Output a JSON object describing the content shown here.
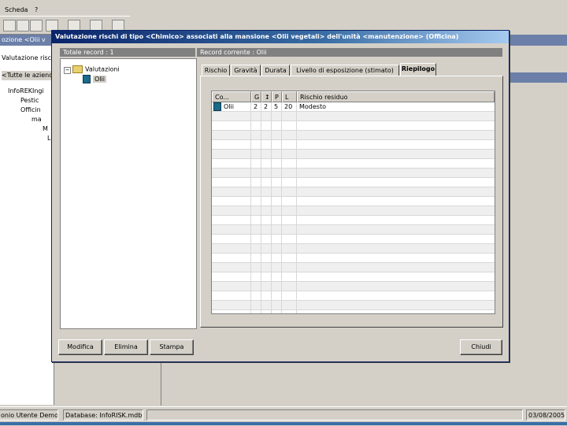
{
  "app": {
    "menu": [
      "Scheda",
      "?"
    ],
    "left_title": "ozione <Olii v",
    "left_items": [
      "Valutazione risch",
      "<Tutte le aziende",
      "InfoREKIngi",
      "Pestic",
      "Officin",
      "ma",
      "M",
      "L"
    ],
    "status": {
      "user": "onio  Utente Demo",
      "database": "Database: InfoRISK.mdb",
      "date": "03/08/2005"
    }
  },
  "dialog": {
    "title": "Valutazione rischi di tipo <Chimico> associati alla mansione <Olii vegetali> dell'unità <manutenzione> (Officina)",
    "left_header": "Totale record : 1",
    "right_header": "Record corrente : Olii",
    "tree": {
      "root": "Valutazioni",
      "child": "Olii",
      "expander": "−"
    },
    "tabs": [
      "Rischio",
      "Gravità",
      "Durata",
      "Livello di esposizione (stimato)",
      "Riepilogo"
    ],
    "active_tab": "Riepilogo",
    "grid": {
      "columns": [
        "Co...",
        "G",
        "↕",
        "P",
        "L",
        "Rischio residuo"
      ],
      "rows": [
        {
          "name": "Olii",
          "g": "2",
          "d": "2",
          "p": "5",
          "l": "20",
          "risk": "Modesto"
        }
      ]
    },
    "buttons": {
      "edit": "Modifica",
      "delete": "Elimina",
      "print": "Stampa",
      "close": "Chiudi"
    }
  }
}
